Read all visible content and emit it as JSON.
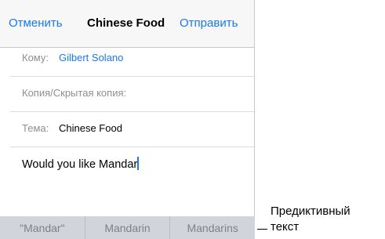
{
  "navbar": {
    "cancel_label": "Отменить",
    "title": "Chinese Food",
    "send_label": "Отправить"
  },
  "fields": {
    "to_label": "Кому:",
    "to_value": "Gilbert Solano",
    "cc_label": "Копия/Скрытая копия:",
    "subject_label": "Тема:",
    "subject_value": "Chinese Food"
  },
  "body": {
    "text": "Would you like Mandar"
  },
  "predictive": {
    "suggestions": [
      "\"Mandar\"",
      "Mandarin",
      "Mandarins"
    ]
  },
  "callout": {
    "line1": "Предиктивный",
    "line2": "текст"
  },
  "colors": {
    "accent": "#1878f0",
    "predictive_bar": "#d1d4db",
    "label_gray": "#8e8e93"
  }
}
